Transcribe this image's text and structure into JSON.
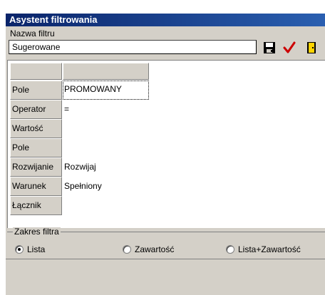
{
  "window": {
    "title": "Asystent filtrowania"
  },
  "filter_name": {
    "label": "Nazwa filtru",
    "value": "Sugerowane"
  },
  "toolbar": {
    "save_icon": "floppy-disk-icon",
    "ok_icon": "checkmark-icon",
    "exit_icon": "exit-door-icon",
    "ok_color": "#cc0000"
  },
  "grid": {
    "rows": [
      {
        "label": "Pole",
        "value": "PROMOWANY"
      },
      {
        "label": "Operator",
        "value": "="
      },
      {
        "label": "Wartość",
        "value": ""
      },
      {
        "label": "Pole",
        "value": ""
      },
      {
        "label": "Rozwijanie",
        "value": "Rozwijaj"
      },
      {
        "label": "Warunek",
        "value": "Spełniony"
      },
      {
        "label": "Łącznik",
        "value": ""
      }
    ]
  },
  "scope": {
    "title": "Zakres filtra",
    "options": [
      {
        "label": "Lista",
        "checked": true
      },
      {
        "label": "Zawartość",
        "checked": false
      },
      {
        "label": "Lista+Zawartość",
        "checked": false
      }
    ]
  }
}
